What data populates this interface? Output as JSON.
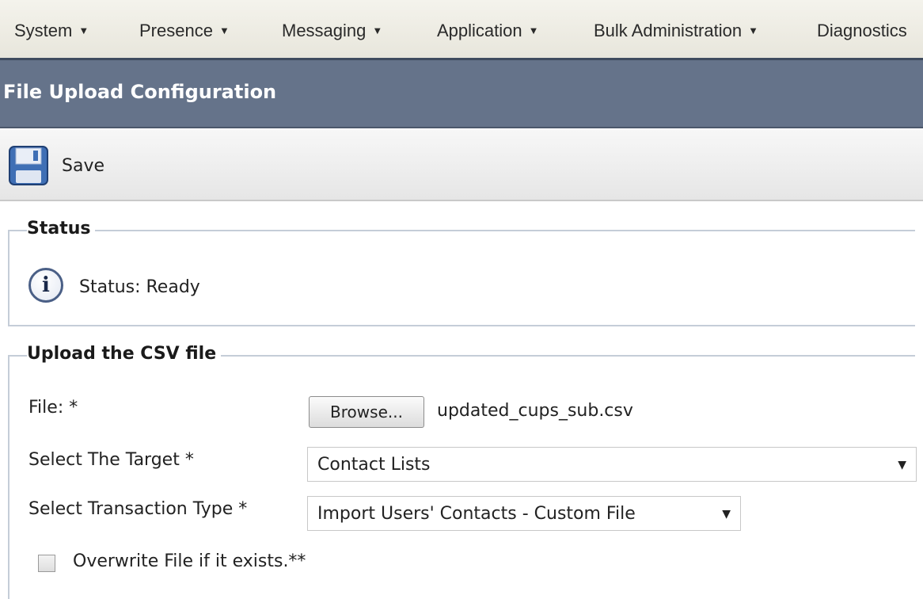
{
  "menu": {
    "items": [
      {
        "label": "System"
      },
      {
        "label": "Presence"
      },
      {
        "label": "Messaging"
      },
      {
        "label": "Application"
      },
      {
        "label": "Bulk Administration"
      },
      {
        "label": "Diagnostics"
      }
    ]
  },
  "page": {
    "title": "File Upload Configuration"
  },
  "toolbar": {
    "save_label": "Save",
    "save_icon": "floppy-disk-icon"
  },
  "status": {
    "legend": "Status",
    "icon": "info-icon",
    "icon_glyph": "i",
    "text": "Status: Ready"
  },
  "upload": {
    "legend": "Upload the CSV file",
    "file_label": "File: *",
    "browse_label": "Browse...",
    "file_name": "updated_cups_sub.csv",
    "target_label": "Select The Target *",
    "target_value": "Contact Lists",
    "transaction_label": "Select Transaction Type *",
    "transaction_value": "Import Users' Contacts - Custom File",
    "overwrite_label": "Overwrite File if it exists.**",
    "overwrite_checked": false
  },
  "colors": {
    "title_bar": "#65738a",
    "menu_bar": "#eeede5",
    "fieldset_border": "#c5cdd8"
  }
}
